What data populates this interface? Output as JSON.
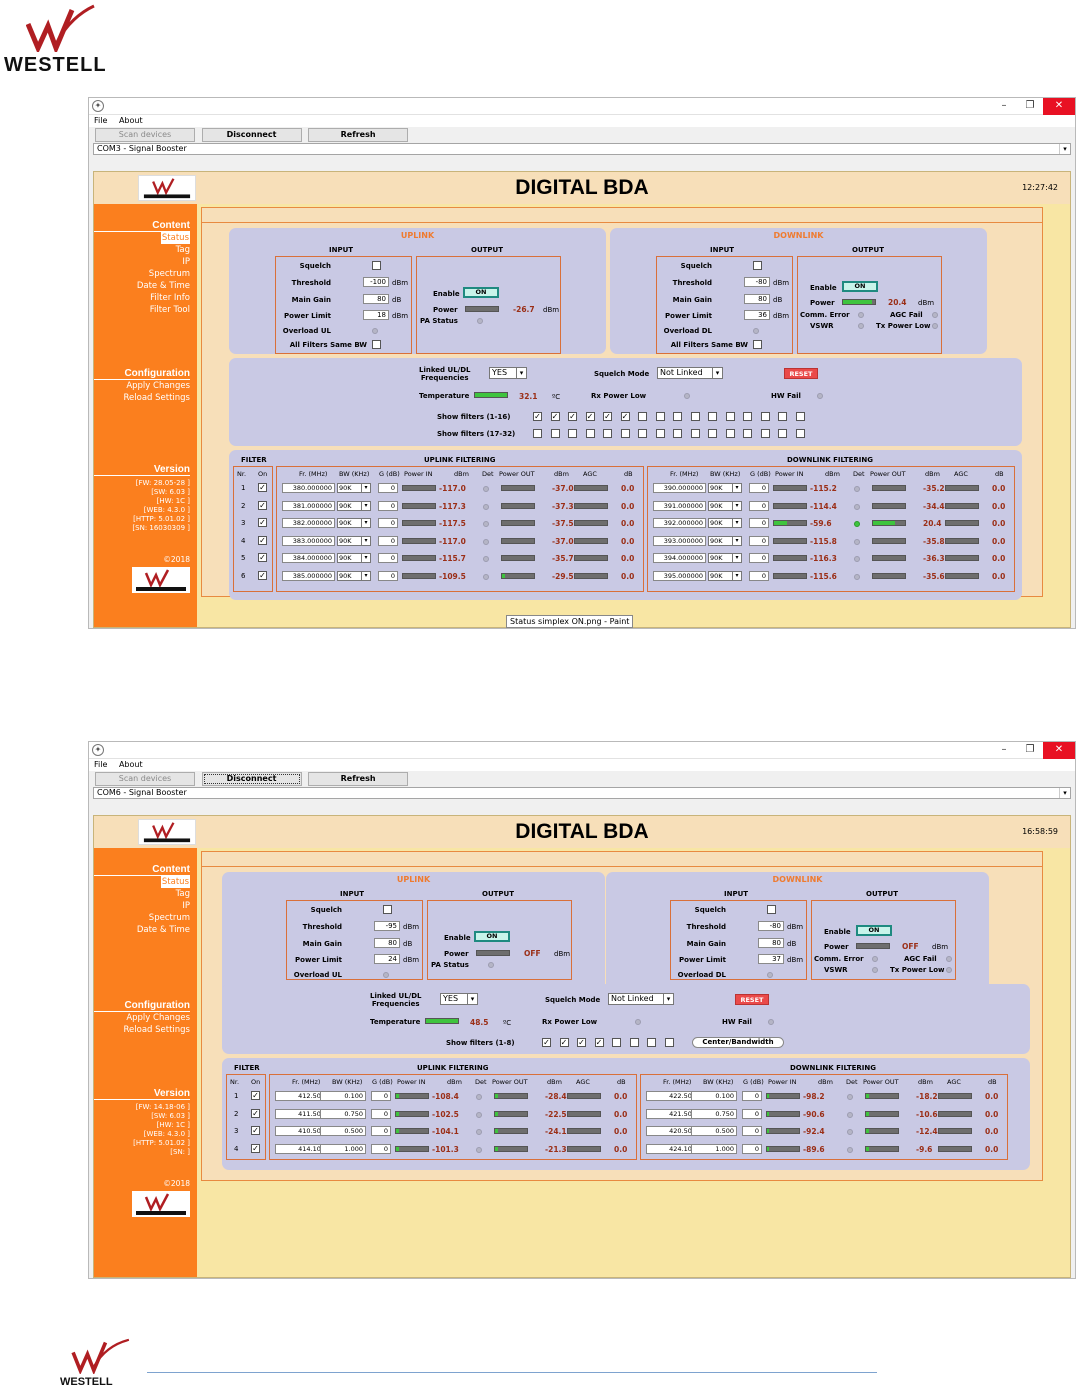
{
  "brand": {
    "name": "WESTELL"
  },
  "tooltip": "Status simplex ON.png - Paint",
  "menu": {
    "file": "File",
    "about": "About"
  },
  "toolbar": {
    "scan": "Scan devices",
    "disconnect": "Disconnect",
    "refresh": "Refresh"
  },
  "colors": {
    "orange": "#fb7f1e",
    "panel": "#c9c9e4",
    "value": "#9a2e16",
    "content_bg": "#f8e6a4"
  },
  "common": {
    "title": "DIGITAL BDA",
    "sidebar": {
      "content_heading": "Content",
      "configuration_heading": "Configuration",
      "apply_changes": "Apply Changes",
      "reload_settings": "Reload Settings",
      "version_heading": "Version",
      "copyright": "©2018"
    },
    "uplink": "UPLINK",
    "downlink": "DOWNLINK",
    "input": "INPUT",
    "output": "OUTPUT",
    "squelch": "Squelch",
    "threshold": "Threshold",
    "main_gain": "Main Gain",
    "power_limit": "Power Limit",
    "overload_ul": "Overload UL",
    "overload_dl": "Overload DL",
    "all_filters": "All Filters Same BW",
    "enable": "Enable",
    "on": "ON",
    "power": "Power",
    "pa_status": "PA Status",
    "comm_error": "Comm. Error",
    "agc_fail": "AGC Fail",
    "vswr": "VSWR",
    "tx_power_low": "Tx Power Low",
    "dbm": "dBm",
    "db": "dB",
    "linked": "Linked UL/DL\nFrequencies",
    "squelch_mode": "Squelch Mode",
    "reset": "RESET",
    "temperature": "Temperature",
    "celsius": "ºC",
    "rx_power_low": "Rx Power Low",
    "hw_fail": "HW Fail",
    "filter": "FILTER",
    "uplink_filtering": "UPLINK FILTERING",
    "downlink_filtering": "DOWNLINK FILTERING",
    "cols": {
      "nr": "Nr.",
      "on": "On",
      "fr": "Fr. (MHz)",
      "bw": "BW (KHz)",
      "g": "G (dB)",
      "pin": "Power IN",
      "dbm": "dBm",
      "det": "Det",
      "pout": "Power OUT",
      "agc": "AGC",
      "db": "dB"
    },
    "center_bw": "Center/Bandwidth"
  },
  "screen1": {
    "device": "COM3 - Signal Booster",
    "clock": "12:27:42",
    "sidebar_items": [
      "Status",
      "Tag",
      "IP",
      "Spectrum",
      "Date & Time",
      "Filter Info",
      "Filter Tool"
    ],
    "version": [
      "[FW: 28.05-28 ]",
      "[SW: 6.03 ]",
      "[HW: 1C ]",
      "[WEB: 4.3.0 ]",
      "[HTTP: 5.01.02 ]",
      "[SN: 16030309 ]"
    ],
    "ul": {
      "threshold": "-100",
      "main_gain": "80",
      "power_limit": "18",
      "power": "-26.7"
    },
    "dl": {
      "threshold": "-80",
      "main_gain": "80",
      "power_limit": "36",
      "power": "20.4"
    },
    "linked": "YES",
    "squelch_mode": "Not Linked",
    "temperature": "32.1",
    "show1": "Show filters (1-16)",
    "show2": "Show filters (17-32)",
    "rows": [
      {
        "nr": "1",
        "ufr": "380.000000",
        "ubw": "90K",
        "ug": "0",
        "upin": "-117.0",
        "upout": "-37.0",
        "uagc": "0.0",
        "dfr": "390.000000",
        "dbw": "90K",
        "dg": "0",
        "dpin": "-115.2",
        "dpout": "-35.2",
        "dagc": "0.0"
      },
      {
        "nr": "2",
        "ufr": "381.000000",
        "ubw": "90K",
        "ug": "0",
        "upin": "-117.3",
        "upout": "-37.3",
        "uagc": "0.0",
        "dfr": "391.000000",
        "dbw": "90K",
        "dg": "0",
        "dpin": "-114.4",
        "dpout": "-34.4",
        "dagc": "0.0"
      },
      {
        "nr": "3",
        "ufr": "382.000000",
        "ubw": "90K",
        "ug": "0",
        "upin": "-117.5",
        "upout": "-37.5",
        "uagc": "0.0",
        "dfr": "392.000000",
        "dbw": "90K",
        "dg": "0",
        "dpin": "-59.6",
        "dpout": "20.4",
        "dagc": "0.0"
      },
      {
        "nr": "4",
        "ufr": "383.000000",
        "ubw": "90K",
        "ug": "0",
        "upin": "-117.0",
        "upout": "-37.0",
        "uagc": "0.0",
        "dfr": "393.000000",
        "dbw": "90K",
        "dg": "0",
        "dpin": "-115.8",
        "dpout": "-35.8",
        "dagc": "0.0"
      },
      {
        "nr": "5",
        "ufr": "384.000000",
        "ubw": "90K",
        "ug": "0",
        "upin": "-115.7",
        "upout": "-35.7",
        "uagc": "0.0",
        "dfr": "394.000000",
        "dbw": "90K",
        "dg": "0",
        "dpin": "-116.3",
        "dpout": "-36.3",
        "dagc": "0.0"
      },
      {
        "nr": "6",
        "ufr": "385.000000",
        "ubw": "90K",
        "ug": "0",
        "upin": "-109.5",
        "upout": "-29.5",
        "uagc": "0.0",
        "dfr": "395.000000",
        "dbw": "90K",
        "dg": "0",
        "dpin": "-115.6",
        "dpout": "-35.6",
        "dagc": "0.0"
      }
    ]
  },
  "screen2": {
    "device": "COM6 - Signal Booster",
    "clock": "16:58:59",
    "sidebar_items": [
      "Status",
      "Tag",
      "IP",
      "Spectrum",
      "Date & Time"
    ],
    "version": [
      "[FW: 14.18-06 ]",
      "[SW: 6.03 ]",
      "[HW: 1C ]",
      "[WEB: 4.3.0 ]",
      "[HTTP: 5.01.02 ]",
      "[SN: ]"
    ],
    "ul": {
      "threshold": "-95",
      "main_gain": "80",
      "power_limit": "24",
      "power": "OFF"
    },
    "dl": {
      "threshold": "-80",
      "main_gain": "80",
      "power_limit": "37",
      "power": "OFF"
    },
    "linked": "YES",
    "squelch_mode": "Not Linked",
    "temperature": "48.5",
    "show1": "Show filters (1-8)",
    "rows": [
      {
        "nr": "1",
        "ufr": "412.500",
        "ubw": "0.100",
        "ug": "0",
        "upin": "-108.4",
        "upout": "-28.4",
        "uagc": "0.0",
        "dfr": "422.500",
        "dbw": "0.100",
        "dg": "0",
        "dpin": "-98.2",
        "dpout": "-18.2",
        "dagc": "0.0"
      },
      {
        "nr": "2",
        "ufr": "411.500",
        "ubw": "0.750",
        "ug": "0",
        "upin": "-102.5",
        "upout": "-22.5",
        "uagc": "0.0",
        "dfr": "421.500",
        "dbw": "0.750",
        "dg": "0",
        "dpin": "-90.6",
        "dpout": "-10.6",
        "dagc": "0.0"
      },
      {
        "nr": "3",
        "ufr": "410.500",
        "ubw": "0.500",
        "ug": "0",
        "upin": "-104.1",
        "upout": "-24.1",
        "uagc": "0.0",
        "dfr": "420.500",
        "dbw": "0.500",
        "dg": "0",
        "dpin": "-92.4",
        "dpout": "-12.4",
        "dagc": "0.0"
      },
      {
        "nr": "4",
        "ufr": "414.100",
        "ubw": "1.000",
        "ug": "0",
        "upin": "-101.3",
        "upout": "-21.3",
        "uagc": "0.0",
        "dfr": "424.100",
        "dbw": "1.000",
        "dg": "0",
        "dpin": "-89.6",
        "dpout": "-9.6",
        "dagc": "0.0"
      }
    ]
  }
}
